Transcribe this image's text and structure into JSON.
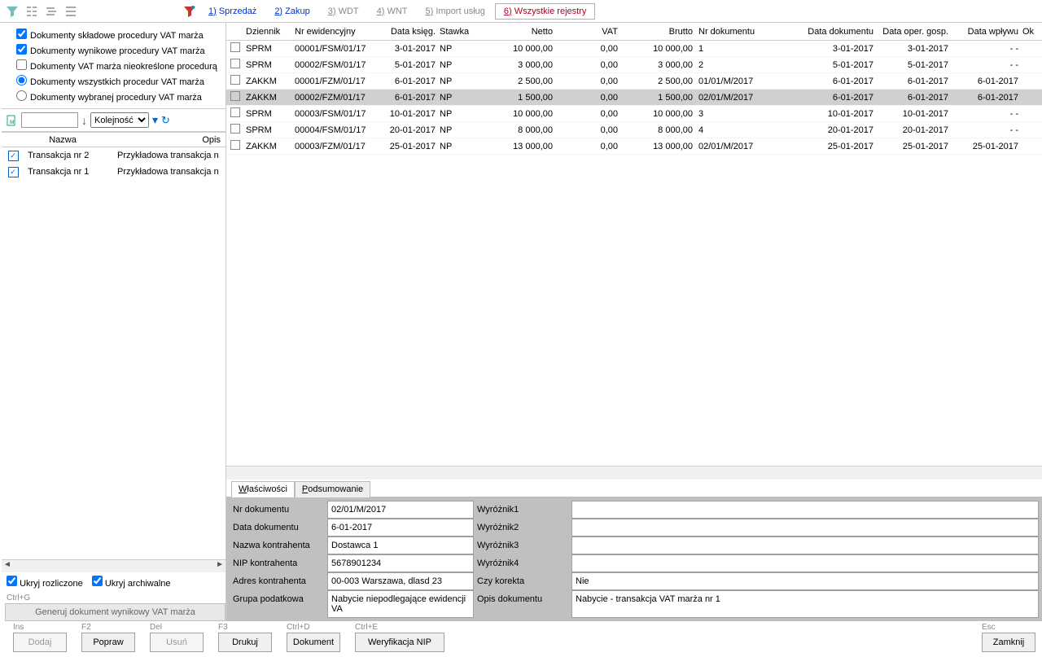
{
  "toolbar": {
    "tabs": [
      {
        "key": "1",
        "label": "Sprzedaż",
        "cls": "active"
      },
      {
        "key": "2",
        "label": "Zakup",
        "cls": "active"
      },
      {
        "key": "3",
        "label": "WDT",
        "cls": ""
      },
      {
        "key": "4",
        "label": "WNT",
        "cls": ""
      },
      {
        "key": "5",
        "label": "Import usług",
        "cls": ""
      },
      {
        "key": "6",
        "label": "Wszystkie rejestry",
        "cls": "red"
      }
    ]
  },
  "filters": {
    "opt1": "Dokumenty składowe procedury VAT marża",
    "opt2": "Dokumenty wynikowe procedury VAT marża",
    "opt3": "Dokumenty VAT marża nieokreślone procedurą",
    "opt4": "Dokumenty wszystkich procedur VAT marża",
    "opt5": "Dokumenty wybranej procedury VAT marża"
  },
  "search": {
    "sort_label": "Kolejność"
  },
  "sidegrid": {
    "head_name": "Nazwa",
    "head_desc": "Opis",
    "rows": [
      {
        "name": "Transakcja nr 2",
        "desc": "Przykładowa transakcja n"
      },
      {
        "name": "Transakcja nr 1",
        "desc": "Przykładowa transakcja n"
      }
    ]
  },
  "side_bottom": {
    "hide_settled": "Ukryj rozliczone",
    "hide_arch": "Ukryj archiwalne",
    "ctrl_g": "Ctrl+G",
    "gen_btn": "Generuj dokument wynikowy VAT marża"
  },
  "grid": {
    "columns": {
      "dziennik": "Dziennik",
      "nrewid": "Nr ewidencyjny",
      "dataks": "Data księg.",
      "stawka": "Stawka",
      "netto": "Netto",
      "vat": "VAT",
      "brutto": "Brutto",
      "nrdok": "Nr dokumentu",
      "datadok": "Data dokumentu",
      "dataoper": "Data oper. gosp.",
      "datawplywu": "Data wpływu",
      "ok": "Ok"
    },
    "rows": [
      {
        "dz": "SPRM",
        "nr": "00001/FSM/01/17",
        "dk": "3-01-2017",
        "st": "NP",
        "ne": "10 000,00",
        "va": "0,00",
        "br": "10 000,00",
        "nd": "1",
        "dd": "3-01-2017",
        "do": "3-01-2017",
        "dw": "- -"
      },
      {
        "dz": "SPRM",
        "nr": "00002/FSM/01/17",
        "dk": "5-01-2017",
        "st": "NP",
        "ne": "3 000,00",
        "va": "0,00",
        "br": "3 000,00",
        "nd": "2",
        "dd": "5-01-2017",
        "do": "5-01-2017",
        "dw": "- -"
      },
      {
        "dz": "ZAKKM",
        "nr": "00001/FZM/01/17",
        "dk": "6-01-2017",
        "st": "NP",
        "ne": "2 500,00",
        "va": "0,00",
        "br": "2 500,00",
        "nd": "01/01/M/2017",
        "dd": "6-01-2017",
        "do": "6-01-2017",
        "dw": "6-01-2017"
      },
      {
        "dz": "ZAKKM",
        "nr": "00002/FZM/01/17",
        "dk": "6-01-2017",
        "st": "NP",
        "ne": "1 500,00",
        "va": "0,00",
        "br": "1 500,00",
        "nd": "02/01/M/2017",
        "dd": "6-01-2017",
        "do": "6-01-2017",
        "dw": "6-01-2017",
        "sel": true
      },
      {
        "dz": "SPRM",
        "nr": "00003/FSM/01/17",
        "dk": "10-01-2017",
        "st": "NP",
        "ne": "10 000,00",
        "va": "0,00",
        "br": "10 000,00",
        "nd": "3",
        "dd": "10-01-2017",
        "do": "10-01-2017",
        "dw": "- -"
      },
      {
        "dz": "SPRM",
        "nr": "00004/FSM/01/17",
        "dk": "20-01-2017",
        "st": "NP",
        "ne": "8 000,00",
        "va": "0,00",
        "br": "8 000,00",
        "nd": "4",
        "dd": "20-01-2017",
        "do": "20-01-2017",
        "dw": "- -"
      },
      {
        "dz": "ZAKKM",
        "nr": "00003/FZM/01/17",
        "dk": "25-01-2017",
        "st": "NP",
        "ne": "13 000,00",
        "va": "0,00",
        "br": "13 000,00",
        "nd": "02/01/M/2017",
        "dd": "25-01-2017",
        "do": "25-01-2017",
        "dw": "25-01-2017"
      }
    ]
  },
  "details": {
    "tab_props": "Właściwości",
    "tab_sum": "Podsumowanie",
    "labels": {
      "nr_dok": "Nr dokumentu",
      "data_dok": "Data dokumentu",
      "nazwa_k": "Nazwa kontrahenta",
      "nip_k": "NIP kontrahenta",
      "adres_k": "Adres kontrahenta",
      "grupa": "Grupa podatkowa",
      "wyr1": "Wyróżnik1",
      "wyr2": "Wyróżnik2",
      "wyr3": "Wyróżnik3",
      "wyr4": "Wyróżnik4",
      "korekta": "Czy korekta",
      "opis": "Opis dokumentu"
    },
    "values": {
      "nr_dok": "02/01/M/2017",
      "data_dok": " 6-01-2017",
      "nazwa_k": "Dostawca 1",
      "nip_k": "5678901234",
      "adres_k": "00-003 Warszawa, dlasd 23",
      "grupa": "Nabycie niepodlegające ewidencji VA",
      "wyr1": "",
      "wyr2": "",
      "wyr3": "",
      "wyr4": "",
      "korekta": "Nie",
      "opis": "Nabycie - transakcja VAT marża nr 1"
    }
  },
  "footer": {
    "ins": "Ins",
    "f2": "F2",
    "del": "Del",
    "f3": "F3",
    "ctrld": "Ctrl+D",
    "ctrle": "Ctrl+E",
    "esc": "Esc",
    "dodaj": "Dodaj",
    "popraw": "Popraw",
    "usun": "Usuń",
    "drukuj": "Drukuj",
    "dokument": "Dokument",
    "weryf": "Weryfikacja NIP",
    "zamknij": "Zamknij"
  }
}
